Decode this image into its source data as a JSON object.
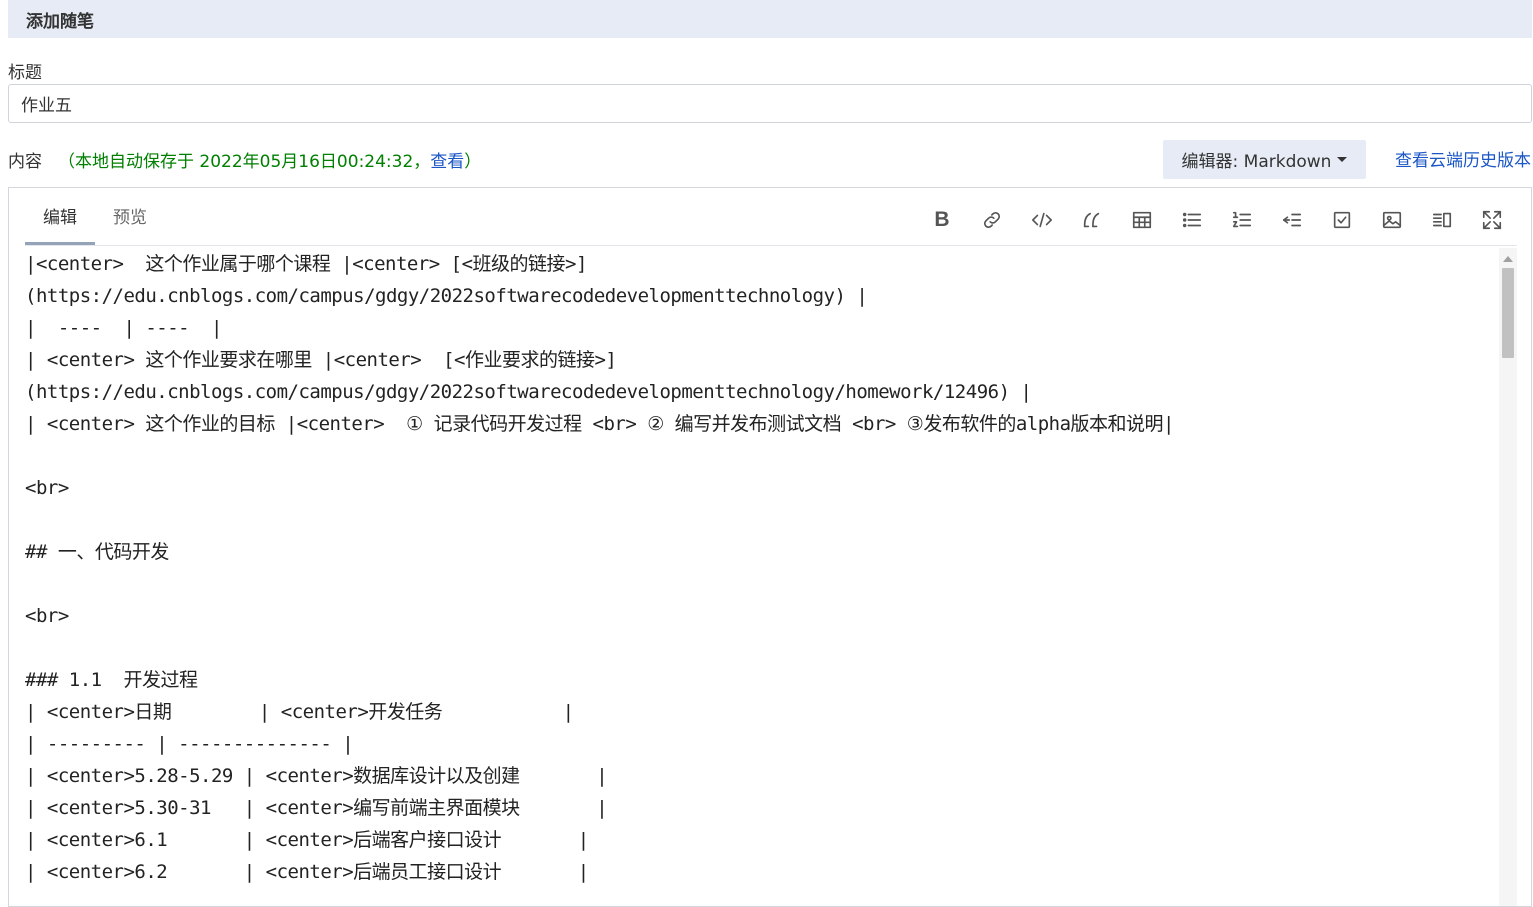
{
  "header": {
    "title": "添加随笔"
  },
  "title_field": {
    "label": "标题",
    "value": "作业五"
  },
  "content": {
    "label": "内容",
    "autosave_prefix": "（本地自动保存于 2022年05月16日00:24:32，",
    "autosave_link": "查看",
    "autosave_suffix": "）"
  },
  "editor_select": {
    "label": "编辑器: Markdown"
  },
  "history_link": "查看云端历史版本",
  "tabs": [
    {
      "label": "编辑"
    },
    {
      "label": "预览"
    }
  ],
  "toolbar": {
    "items": [
      "bold-icon",
      "link-icon",
      "code-icon",
      "quote-icon",
      "table-icon",
      "bullet-list-icon",
      "numbered-list-icon",
      "outdent-icon",
      "checkbox-icon",
      "image-icon",
      "split-view-icon",
      "fullscreen-icon"
    ],
    "bold_glyph": "B"
  },
  "editor_lines": [
    "|<center>  这个作业属于哪个课程 |<center> [<班级的链接>]",
    "(https://edu.cnblogs.com/campus/gdgy/2022softwarecodedevelopmenttechnology) |",
    "|  ----  | ----  |",
    "| <center> 这个作业要求在哪里 |<center>  [<作业要求的链接>]",
    "(https://edu.cnblogs.com/campus/gdgy/2022softwarecodedevelopmenttechnology/homework/12496) |",
    "| <center> 这个作业的目标 |<center>  ① 记录代码开发过程 <br> ② 编写并发布测试文档 <br> ③发布软件的alpha版本和说明|",
    "",
    "<br>",
    "",
    "## 一、代码开发",
    "",
    "<br>",
    "",
    "### 1.1  开发过程",
    "| <center>日期        | <center>开发任务           |",
    "| --------- | -------------- |",
    "| <center>5.28-5.29 | <center>数据库设计以及创建       |",
    "| <center>5.30-31   | <center>编写前端主界面模块       |",
    "| <center>6.1       | <center>后端客户接口设计       |",
    "| <center>6.2       | <center>后端员工接口设计       |"
  ]
}
